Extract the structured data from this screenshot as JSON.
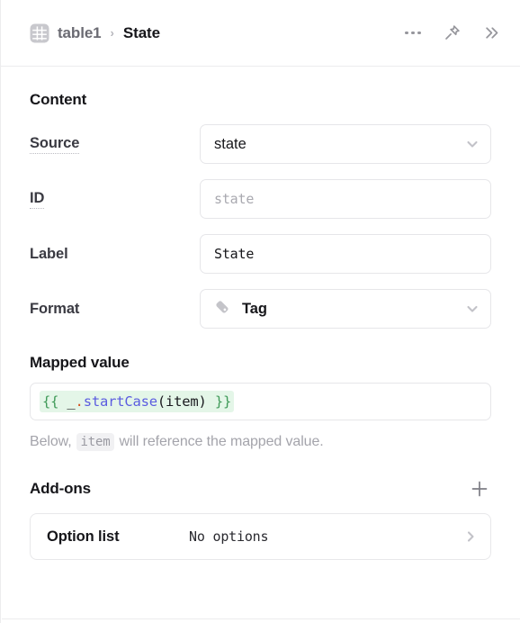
{
  "header": {
    "table_icon": "table-grid-icon",
    "breadcrumb_parent": "table1",
    "breadcrumb_separator": "›",
    "breadcrumb_current": "State",
    "actions": [
      {
        "name": "more-options",
        "icon": "ellipsis-icon"
      },
      {
        "name": "pin",
        "icon": "pin-icon"
      },
      {
        "name": "collapse-panel",
        "icon": "double-chevron-right-icon"
      }
    ]
  },
  "content": {
    "section_title": "Content",
    "source": {
      "label": "Source",
      "value": "state",
      "chevron": "chevron-down-icon"
    },
    "id": {
      "label": "ID",
      "value": "",
      "placeholder": "state"
    },
    "label_field": {
      "label": "Label",
      "value": "State"
    },
    "format": {
      "label": "Format",
      "value": "Tag",
      "icon": "tag-icon",
      "chevron": "chevron-down-icon"
    }
  },
  "mapped_value": {
    "title": "Mapped value",
    "expression": "{{ _.startCase(item) }}",
    "tokens": {
      "open_brace": "{{",
      "space1": " ",
      "underscore": "_",
      "dot": ".",
      "fn": "startCase",
      "args": "(item)",
      "space2": " ",
      "close_brace": "}}"
    },
    "hint_prefix": "Below,",
    "hint_code": "item",
    "hint_suffix": "will reference the mapped value."
  },
  "addons": {
    "title": "Add-ons",
    "add_icon": "plus-icon",
    "items": [
      {
        "name": "Option list",
        "value": "No options",
        "chevron": "chevron-right-icon"
      }
    ]
  },
  "colors": {
    "accent_green": "#3f9a58",
    "code_bg": "#e4f6e8",
    "fn_blue": "#5b5ce0",
    "dot_orange": "#d4521f",
    "border": "#e6e6e9",
    "text": "#16161a",
    "muted": "#a4a4ab"
  }
}
